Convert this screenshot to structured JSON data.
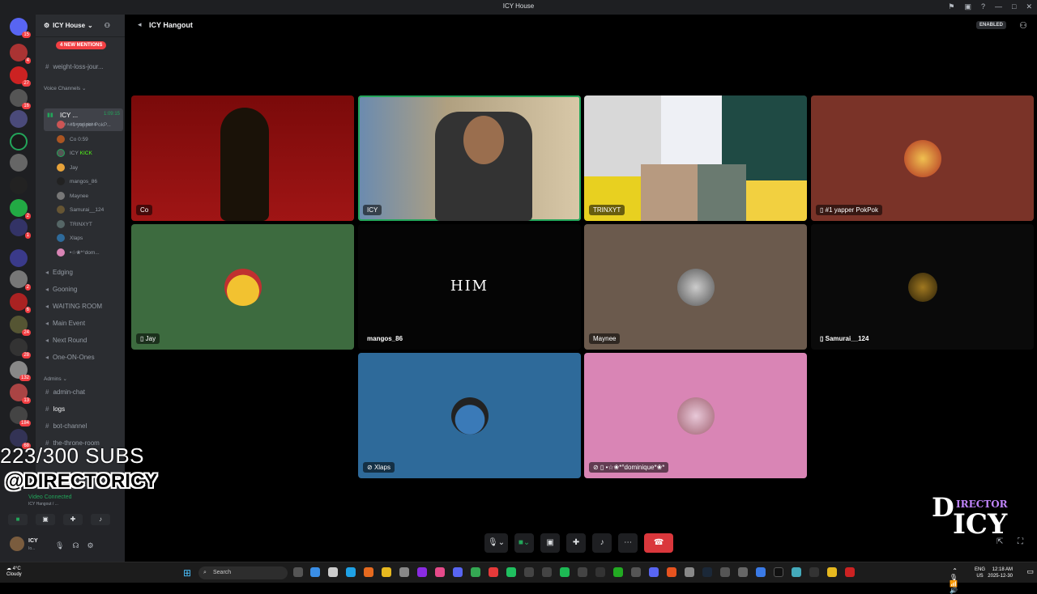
{
  "window": {
    "title": "ICY House"
  },
  "server": {
    "name": "ICY House",
    "mentions": "4 NEW MENTIONS"
  },
  "server_badges": [
    "15",
    "4",
    "27",
    "16",
    "2",
    "1",
    "2",
    "6",
    "24",
    "28",
    "132",
    "13",
    "184",
    "68",
    "1"
  ],
  "channels": [
    {
      "name": "weight-loss-jour..."
    }
  ],
  "voice_category": "Voice Channels",
  "voice_channel": {
    "name": "ICY ...",
    "time": "1:09:15",
    "status": "Set a channel status"
  },
  "voice_members": [
    "#1 yapper PokP...",
    "Co",
    "ICY",
    "Jay",
    "mangos_86",
    "Maynee",
    "Samurai__124",
    "TRINXYT",
    "Xlaps",
    "•☆❀*°dom..."
  ],
  "member_extras": {
    "co": "0:59",
    "icy": "KICK"
  },
  "more_channels": [
    "Edging",
    "Gooning",
    "WAITING ROOM",
    "Main Event",
    "Next Round",
    "One-ON-Ones"
  ],
  "admin_category": "Admins",
  "admin_channels": [
    "admin-chat",
    "logs",
    "bot-channel",
    "the-throne-room"
  ],
  "user_panel": {
    "voice_connected": "Video Connected",
    "voice_sub": "ICY Hangout / ...",
    "username": "ICY",
    "usersub": "Io..."
  },
  "overlay": {
    "subs": "223/300 SUBS",
    "handle": "@DIRECTORICY"
  },
  "call": {
    "room": "ICY Hangout",
    "enabled": "ENABLED"
  },
  "tiles": [
    {
      "label": "Co"
    },
    {
      "label": "ICY"
    },
    {
      "label": "TRINXYT"
    },
    {
      "label": "#1 yapper PokPok"
    },
    {
      "label": "Jay"
    },
    {
      "label": "mangos_86",
      "center_text": "HIM"
    },
    {
      "label": "Maynee"
    },
    {
      "label": "Samurai__124"
    },
    {
      "label": "Xlaps"
    },
    {
      "label": "•☆❀*°dominique*❀*"
    }
  ],
  "logo": {
    "line1": "D",
    "line2": "IRECTOR",
    "line3": "ICY"
  },
  "taskbar": {
    "weather_temp": "4°C",
    "weather_desc": "Cloudy",
    "search": "Search",
    "lang": "ENG",
    "region": "US",
    "time": "12:18 AM",
    "date": "2025-12-30"
  },
  "colors": {
    "speaking": "#23a55a",
    "hangup": "#da373c",
    "tile_co": "#8c0f0f",
    "tile_pokpok": "#7a3328",
    "tile_jay": "#3d6b3f",
    "tile_mangos": "#050505",
    "tile_maynee": "#6b5a4d",
    "tile_samurai": "#0a0a0a",
    "tile_xlaps": "#2e6a9a",
    "tile_dominique": "#d985b5"
  }
}
